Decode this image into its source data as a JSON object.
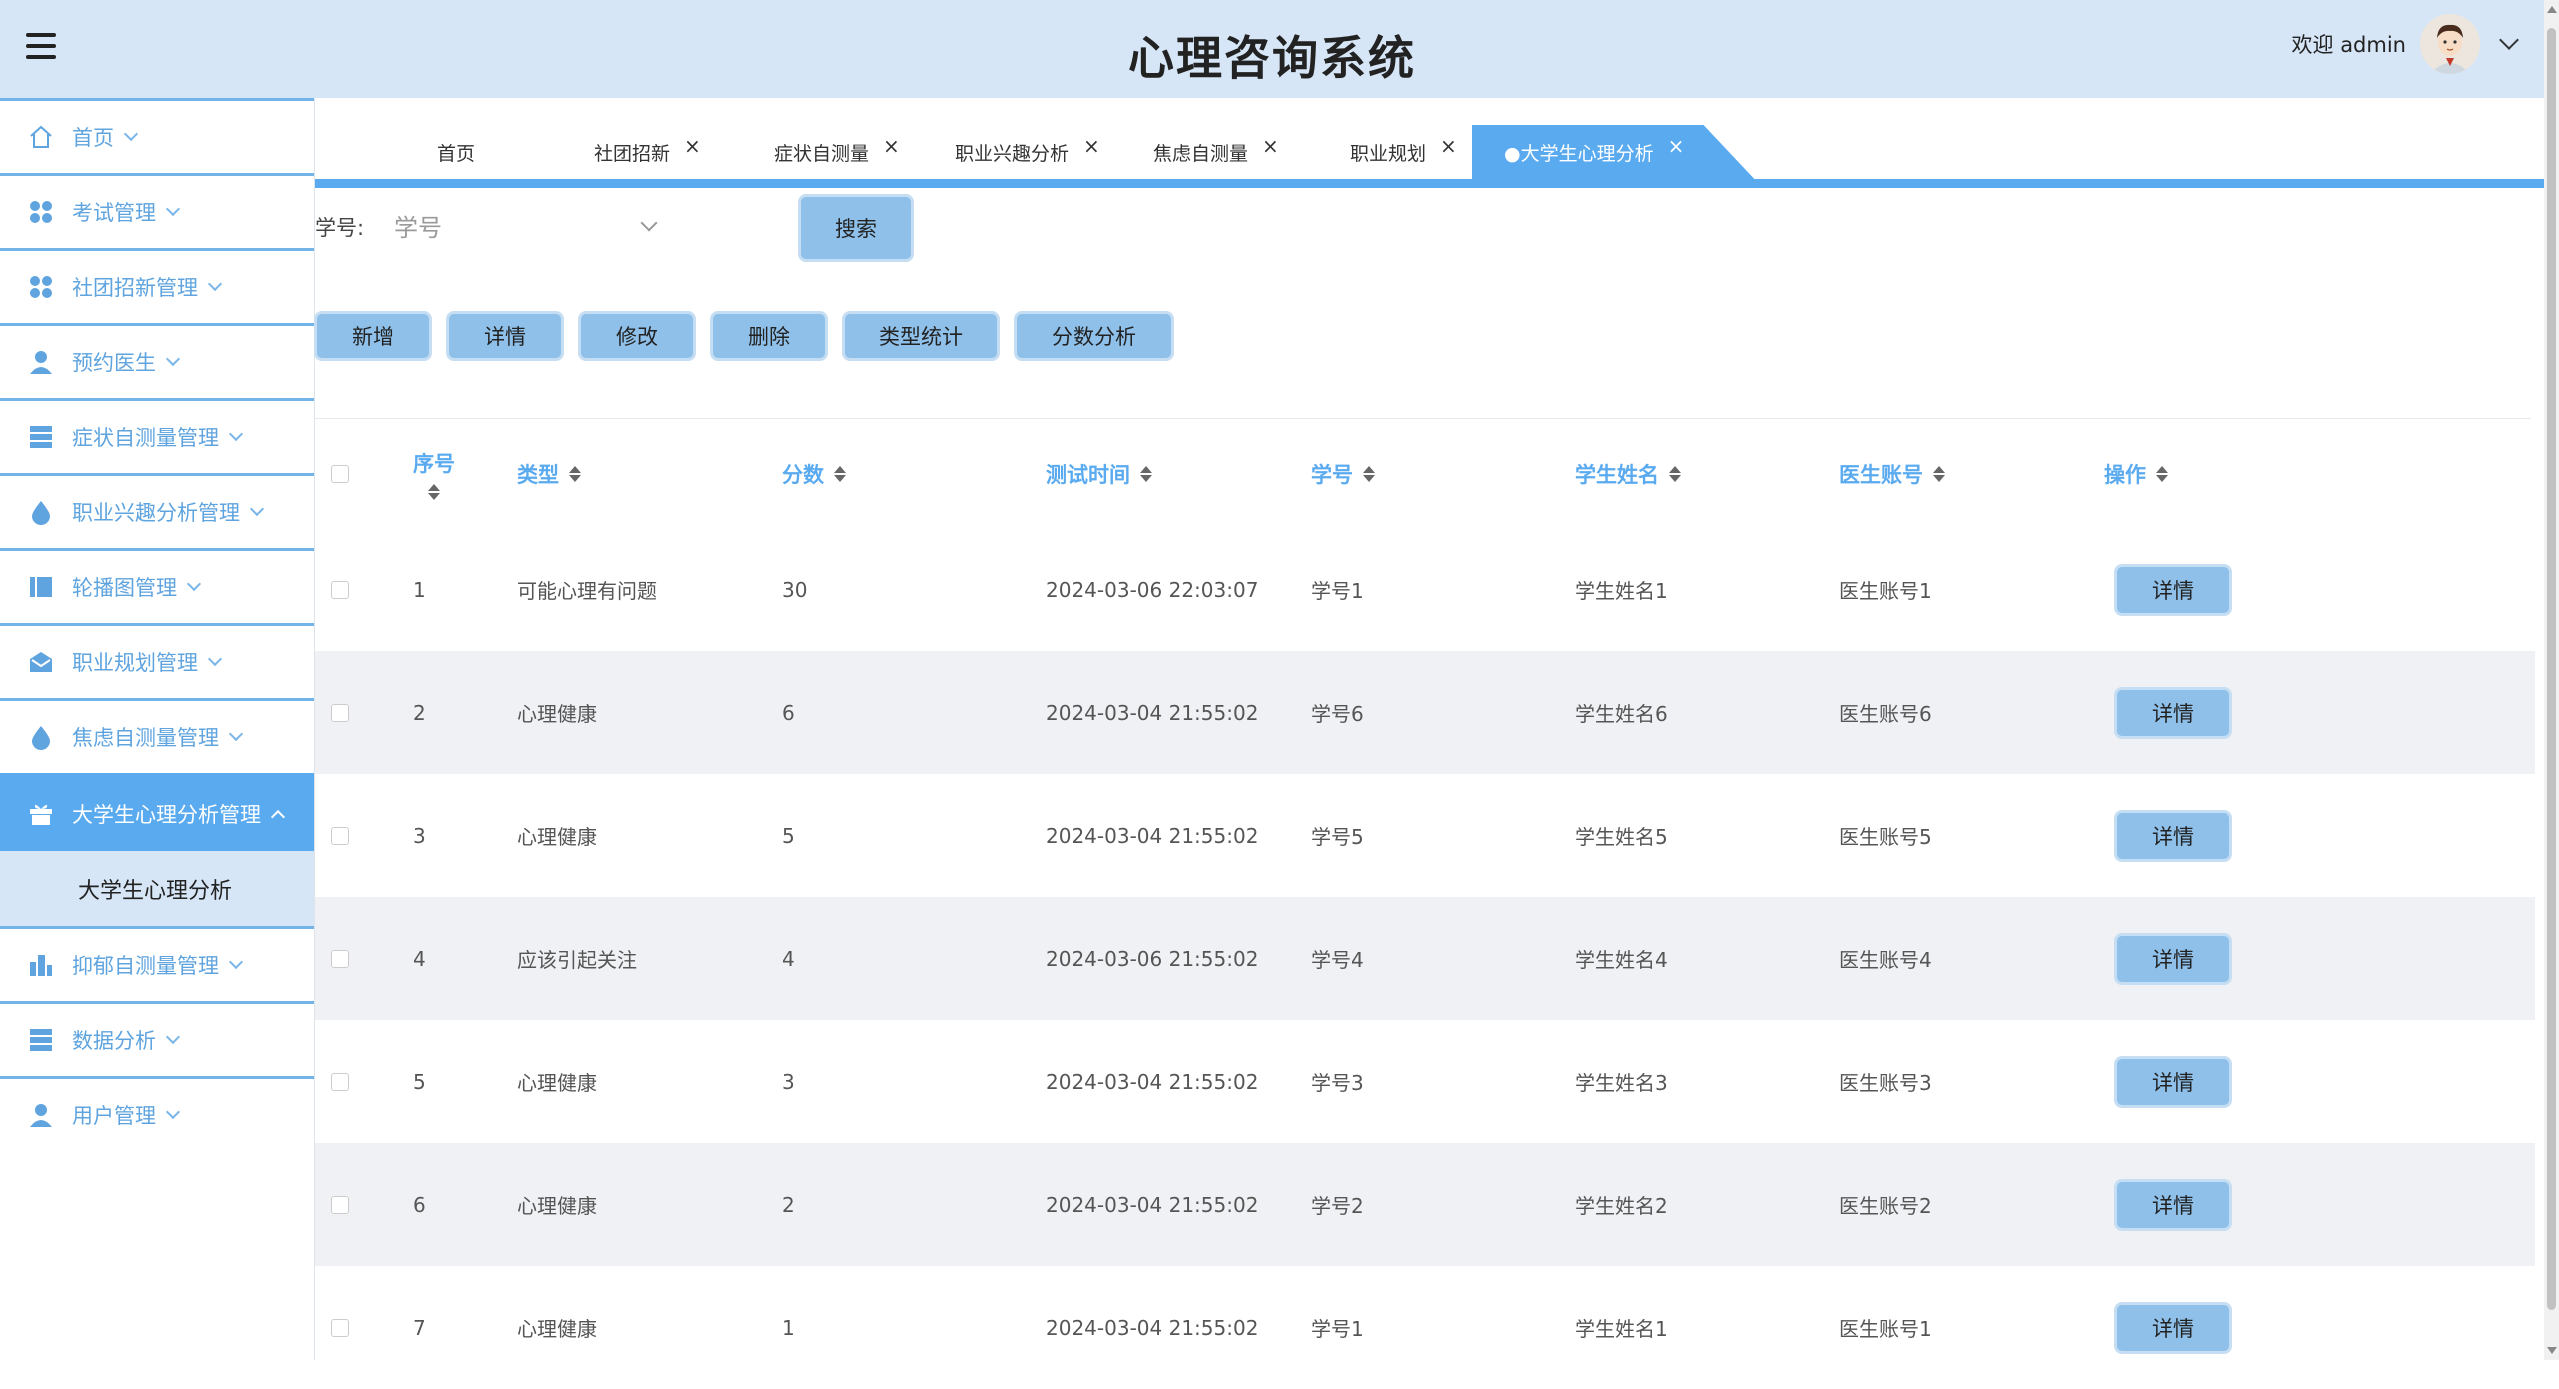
{
  "header": {
    "title": "心理咨询系统",
    "welcome": "欢迎 admin",
    "menu_icon": "hamburger-icon",
    "avatar_icon": "user-avatar"
  },
  "sidebar": {
    "items": [
      {
        "label": "首页",
        "icon": "home-icon"
      },
      {
        "label": "考试管理",
        "icon": "grid-icon"
      },
      {
        "label": "社团招新管理",
        "icon": "grid-icon"
      },
      {
        "label": "预约医生",
        "icon": "person-icon"
      },
      {
        "label": "症状自测量管理",
        "icon": "database-icon"
      },
      {
        "label": "职业兴趣分析管理",
        "icon": "drop-icon"
      },
      {
        "label": "轮播图管理",
        "icon": "book-icon"
      },
      {
        "label": "职业规划管理",
        "icon": "mail-icon"
      },
      {
        "label": "焦虑自测量管理",
        "icon": "drop-icon"
      },
      {
        "label": "大学生心理分析管理",
        "icon": "gift-icon",
        "expanded": true
      },
      {
        "label": "抑郁自测量管理",
        "icon": "building-icon"
      },
      {
        "label": "数据分析",
        "icon": "database-icon"
      },
      {
        "label": "用户管理",
        "icon": "person-icon"
      }
    ],
    "sub_item": "大学生心理分析"
  },
  "tabs": [
    {
      "label": "首页"
    },
    {
      "label": "社团招新"
    },
    {
      "label": "症状自测量"
    },
    {
      "label": "职业兴趣分析"
    },
    {
      "label": "焦虑自测量"
    },
    {
      "label": "职业规划"
    },
    {
      "label": "●大学生心理分析"
    }
  ],
  "search": {
    "label": "学号:",
    "placeholder": "学号",
    "button": "搜索"
  },
  "actions": {
    "add": "新增",
    "detail": "详情",
    "edit": "修改",
    "delete": "删除",
    "type_stats": "类型统计",
    "score_analysis": "分数分析"
  },
  "table": {
    "headers": [
      "序号",
      "类型",
      "分数",
      "测试时间",
      "学号",
      "学生姓名",
      "医生账号",
      "操作"
    ],
    "detail_label": "详情",
    "rows": [
      {
        "no": "1",
        "type": "可能心理有问题",
        "score": "30",
        "time": "2024-03-06 22:03:07",
        "sid": "学号1",
        "name": "学生姓名1",
        "doctor": "医生账号1"
      },
      {
        "no": "2",
        "type": "心理健康",
        "score": "6",
        "time": "2024-03-04 21:55:02",
        "sid": "学号6",
        "name": "学生姓名6",
        "doctor": "医生账号6"
      },
      {
        "no": "3",
        "type": "心理健康",
        "score": "5",
        "time": "2024-03-04 21:55:02",
        "sid": "学号5",
        "name": "学生姓名5",
        "doctor": "医生账号5"
      },
      {
        "no": "4",
        "type": "应该引起关注",
        "score": "4",
        "time": "2024-03-06 21:55:02",
        "sid": "学号4",
        "name": "学生姓名4",
        "doctor": "医生账号4"
      },
      {
        "no": "5",
        "type": "心理健康",
        "score": "3",
        "time": "2024-03-04 21:55:02",
        "sid": "学号3",
        "name": "学生姓名3",
        "doctor": "医生账号3"
      },
      {
        "no": "6",
        "type": "心理健康",
        "score": "2",
        "time": "2024-03-04 21:55:02",
        "sid": "学号2",
        "name": "学生姓名2",
        "doctor": "医生账号2"
      },
      {
        "no": "7",
        "type": "心理健康",
        "score": "1",
        "time": "2024-03-04 21:55:02",
        "sid": "学号1",
        "name": "学生姓名1",
        "doctor": "医生账号1"
      }
    ]
  },
  "colors": {
    "accent": "#5aaaf0",
    "header_bg": "#d6e6f6",
    "button_bg": "#8ec0ea",
    "row_alt": "#eff1f4"
  }
}
